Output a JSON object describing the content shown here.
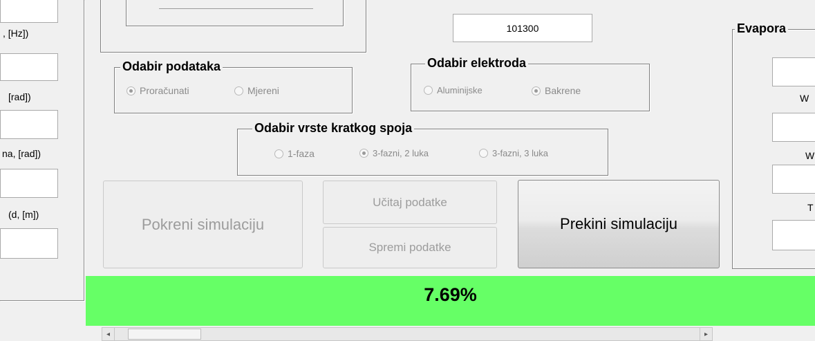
{
  "left_panel": {
    "label_hz": ", [Hz])",
    "label_rad1": "[rad])",
    "label_rad2": "na, [rad])",
    "label_dm": "(d, [m])"
  },
  "pressure_value": "101300",
  "data_group": {
    "title": "Odabir podataka",
    "options": [
      "Proračunati",
      "Mjereni"
    ],
    "selected": 0
  },
  "electrode_group": {
    "title": "Odabir elektroda",
    "options": [
      "Aluminijske",
      "Bakrene"
    ],
    "selected": 1
  },
  "short_circuit_group": {
    "title": "Odabir vrste kratkog spoja",
    "options": [
      "1-faza",
      "3-fazni, 2 luka",
      "3-fazni, 3 luka"
    ],
    "selected": 1
  },
  "buttons": {
    "run": "Pokreni simulaciju",
    "load": "Učitaj podatke",
    "save": "Spremi podatke",
    "stop": "Prekini simulaciju"
  },
  "progress": {
    "text": "7.69%",
    "fraction": 0.0769,
    "color": "#66ff66"
  },
  "right_panel": {
    "title": "Evapora",
    "label_1": "W",
    "label_2": "W",
    "label_3": "T",
    "value_2": "("
  },
  "scrollbar": {
    "left_arrow": "◂",
    "right_arrow": "▸"
  }
}
